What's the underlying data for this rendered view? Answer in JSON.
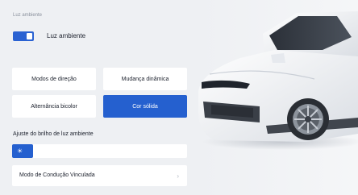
{
  "section": {
    "title": "Luz ambiente"
  },
  "toggle": {
    "label": "Luz ambiente",
    "on": true
  },
  "modes": {
    "directional": "Modos de direção",
    "dynamic": "Mudança dinâmica",
    "bicolor": "Alternância bicolor",
    "solid": "Cor sólida",
    "active": "solid"
  },
  "brightness": {
    "title": "Ajuste do brilho de luz ambiente",
    "level": 0.12
  },
  "linked_mode": {
    "label": "Modo de Condução Vinculada"
  },
  "icons": {
    "slider": "sun-icon",
    "chevron": "chevron-right-icon"
  },
  "colors": {
    "accent": "#2560cf",
    "background": "#eceef2",
    "card": "#ffffff"
  }
}
